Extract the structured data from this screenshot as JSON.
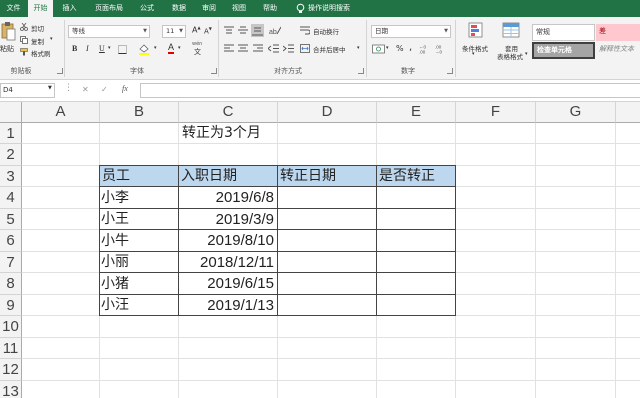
{
  "tabs": [
    {
      "label": "文件",
      "active": false
    },
    {
      "label": "开始",
      "active": true
    },
    {
      "label": "插入",
      "active": false
    },
    {
      "label": "页面布局",
      "active": false
    },
    {
      "label": "公式",
      "active": false
    },
    {
      "label": "数据",
      "active": false
    },
    {
      "label": "审阅",
      "active": false
    },
    {
      "label": "视图",
      "active": false
    },
    {
      "label": "帮助",
      "active": false
    },
    {
      "label": "操作说明搜索",
      "active": false
    }
  ],
  "clipboard": {
    "paste": "粘贴",
    "cut": "剪切",
    "copy": "复制",
    "format_painter": "格式刷",
    "group_label": "剪贴板"
  },
  "font": {
    "name": "等线",
    "size": "11",
    "bold": "B",
    "italic": "I",
    "underline": "U",
    "font_color_letter": "A",
    "wen": "wén",
    "group_label": "字体"
  },
  "alignment": {
    "wrap_text": "自动换行",
    "merge_center": "合并后居中",
    "group_label": "对齐方式"
  },
  "number": {
    "format": "日期",
    "percent": "%",
    "comma": ",",
    "group_label": "数字"
  },
  "styles": {
    "conditional": "条件格式",
    "as_table_line1": "套用",
    "as_table_line2": "表格格式",
    "normal": "常规",
    "check_cell": "检查单元格",
    "bad": "差",
    "explanatory": "解释性文本"
  },
  "formula_bar": {
    "name_box": "D4",
    "cancel": "✕",
    "enter": "✓",
    "fx": "fx"
  },
  "columns": [
    "A",
    "B",
    "C",
    "D",
    "E",
    "F",
    "G"
  ],
  "rows": [
    "1",
    "2",
    "3",
    "4",
    "5",
    "6",
    "7",
    "8",
    "9",
    "10",
    "11",
    "12",
    "13"
  ],
  "sheet": {
    "title": "转正为3个月",
    "headers": [
      "员工",
      "入职日期",
      "转正日期",
      "是否转正"
    ],
    "data": [
      {
        "name": "小李",
        "date": "2019/6/8"
      },
      {
        "name": "小王",
        "date": "2019/3/9"
      },
      {
        "name": "小牛",
        "date": "2019/8/10"
      },
      {
        "name": "小丽",
        "date": "2018/12/11"
      },
      {
        "name": "小猪",
        "date": "2019/6/15"
      },
      {
        "name": "小汪",
        "date": "2019/1/13"
      }
    ]
  },
  "colors": {
    "ribbon_green": "#217346",
    "header_fill": "#bdd7ee",
    "bad_fill": "#ffc7ce",
    "bad_text": "#9c0006",
    "check_fill": "#a5a5a5"
  }
}
